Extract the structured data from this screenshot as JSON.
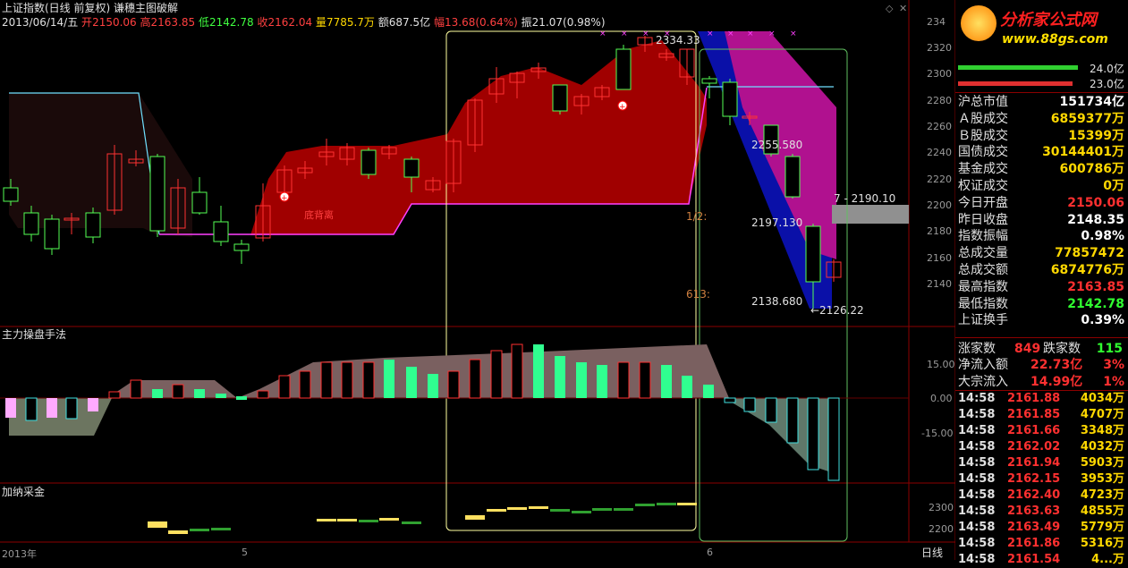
{
  "header": {
    "prefix": "上证指数(日线 前复权) 谦穗主图破解",
    "date": "2013/06/14/五",
    "open_label": "开",
    "open": "2150.06",
    "high_label": "高",
    "high": "2163.85",
    "low_label": "低",
    "low": "2142.78",
    "close_label": "收",
    "close": "2162.04",
    "vol_label": "量",
    "vol": "7785.7万",
    "amt_label": "额",
    "amt": "687.5亿",
    "chg_label": "幅",
    "chg": "13.68(0.64%)",
    "amp_label": "振",
    "amp": "21.07(0.98%)"
  },
  "main_chart": {
    "annotations": {
      "peak": "2334.33",
      "fib1": "2255.580",
      "fib2": "2197.130",
      "fib3": "2138.680",
      "low": "←2126.22",
      "right_label": "7 - 2190.10",
      "half": "1/2:",
      "ratio": "613:",
      "zone_text": "底背离"
    },
    "y_ticks": [
      "234",
      "2320",
      "2300",
      "2280",
      "2260",
      "2240",
      "2220",
      "2200",
      "2180",
      "2160",
      "2140"
    ]
  },
  "sub1": {
    "title": "主力操盘手法",
    "y_ticks": [
      "15.00",
      "0.00",
      "-15.00"
    ]
  },
  "sub2": {
    "title": "加纳采金",
    "y_ticks": [
      "2300",
      "2200"
    ]
  },
  "x_axis": {
    "labels": [
      "2013年",
      "5",
      "6"
    ],
    "period": "日线"
  },
  "logo": {
    "title": "分析家公式网",
    "url": "www.88gs.com"
  },
  "right_panel": {
    "bar1_value": "24.0亿",
    "bar2_value": "23.0亿",
    "stats": [
      {
        "label": "沪总市值",
        "value": "151734亿",
        "color": "#ffffff"
      },
      {
        "label": "Ａ股成交",
        "value": "6859377万",
        "color": "#ffd800"
      },
      {
        "label": "Ｂ股成交",
        "value": "15399万",
        "color": "#ffd800"
      },
      {
        "label": "国债成交",
        "value": "30144401万",
        "color": "#ffd800"
      },
      {
        "label": "基金成交",
        "value": "600786万",
        "color": "#ffd800"
      },
      {
        "label": "权证成交",
        "value": "0万",
        "color": "#ffd800"
      },
      {
        "label": "今日开盘",
        "value": "2150.06",
        "color": "#ff3030"
      },
      {
        "label": "昨日收盘",
        "value": "2148.35",
        "color": "#ffffff"
      },
      {
        "label": "指数振幅",
        "value": "0.98%",
        "color": "#ffffff"
      },
      {
        "label": "总成交量",
        "value": "77857472",
        "color": "#ffd800"
      },
      {
        "label": "总成交额",
        "value": "6874776万",
        "color": "#ffd800"
      },
      {
        "label": "最高指数",
        "value": "2163.85",
        "color": "#ff3030"
      },
      {
        "label": "最低指数",
        "value": "2142.78",
        "color": "#30ff30"
      },
      {
        "label": "上证换手",
        "value": "0.39%",
        "color": "#ffffff"
      }
    ],
    "breadth": {
      "up_label": "涨家数",
      "up": "849",
      "down_label": "跌家数",
      "down": "115"
    },
    "flows": [
      {
        "label": "净流入额",
        "value": "22.73亿",
        "pct": "3%"
      },
      {
        "label": "大宗流入",
        "value": "14.99亿",
        "pct": "1%"
      }
    ],
    "ticks": [
      {
        "time": "14:58",
        "price": "2161.88",
        "vol": "4034万"
      },
      {
        "time": "14:58",
        "price": "2161.85",
        "vol": "4707万"
      },
      {
        "time": "14:58",
        "price": "2161.66",
        "vol": "3348万"
      },
      {
        "time": "14:58",
        "price": "2162.02",
        "vol": "4032万"
      },
      {
        "time": "14:58",
        "price": "2161.94",
        "vol": "5903万"
      },
      {
        "time": "14:58",
        "price": "2162.15",
        "vol": "3953万"
      },
      {
        "time": "14:58",
        "price": "2162.40",
        "vol": "4723万"
      },
      {
        "time": "14:58",
        "price": "2163.63",
        "vol": "4855万"
      },
      {
        "time": "14:58",
        "price": "2163.49",
        "vol": "5779万"
      },
      {
        "time": "14:58",
        "price": "2161.86",
        "vol": "5316万"
      },
      {
        "time": "14:58",
        "price": "2161.54",
        "vol": "4...万"
      }
    ]
  },
  "colors": {
    "up": "#ff3232",
    "down": "#54ff54",
    "fill_red": "#a00000",
    "fill_blue": "#0a10a8",
    "fill_magenta": "#b0118f",
    "frame_yellow": "#ffffa0",
    "frame_green": "#60c060"
  }
}
